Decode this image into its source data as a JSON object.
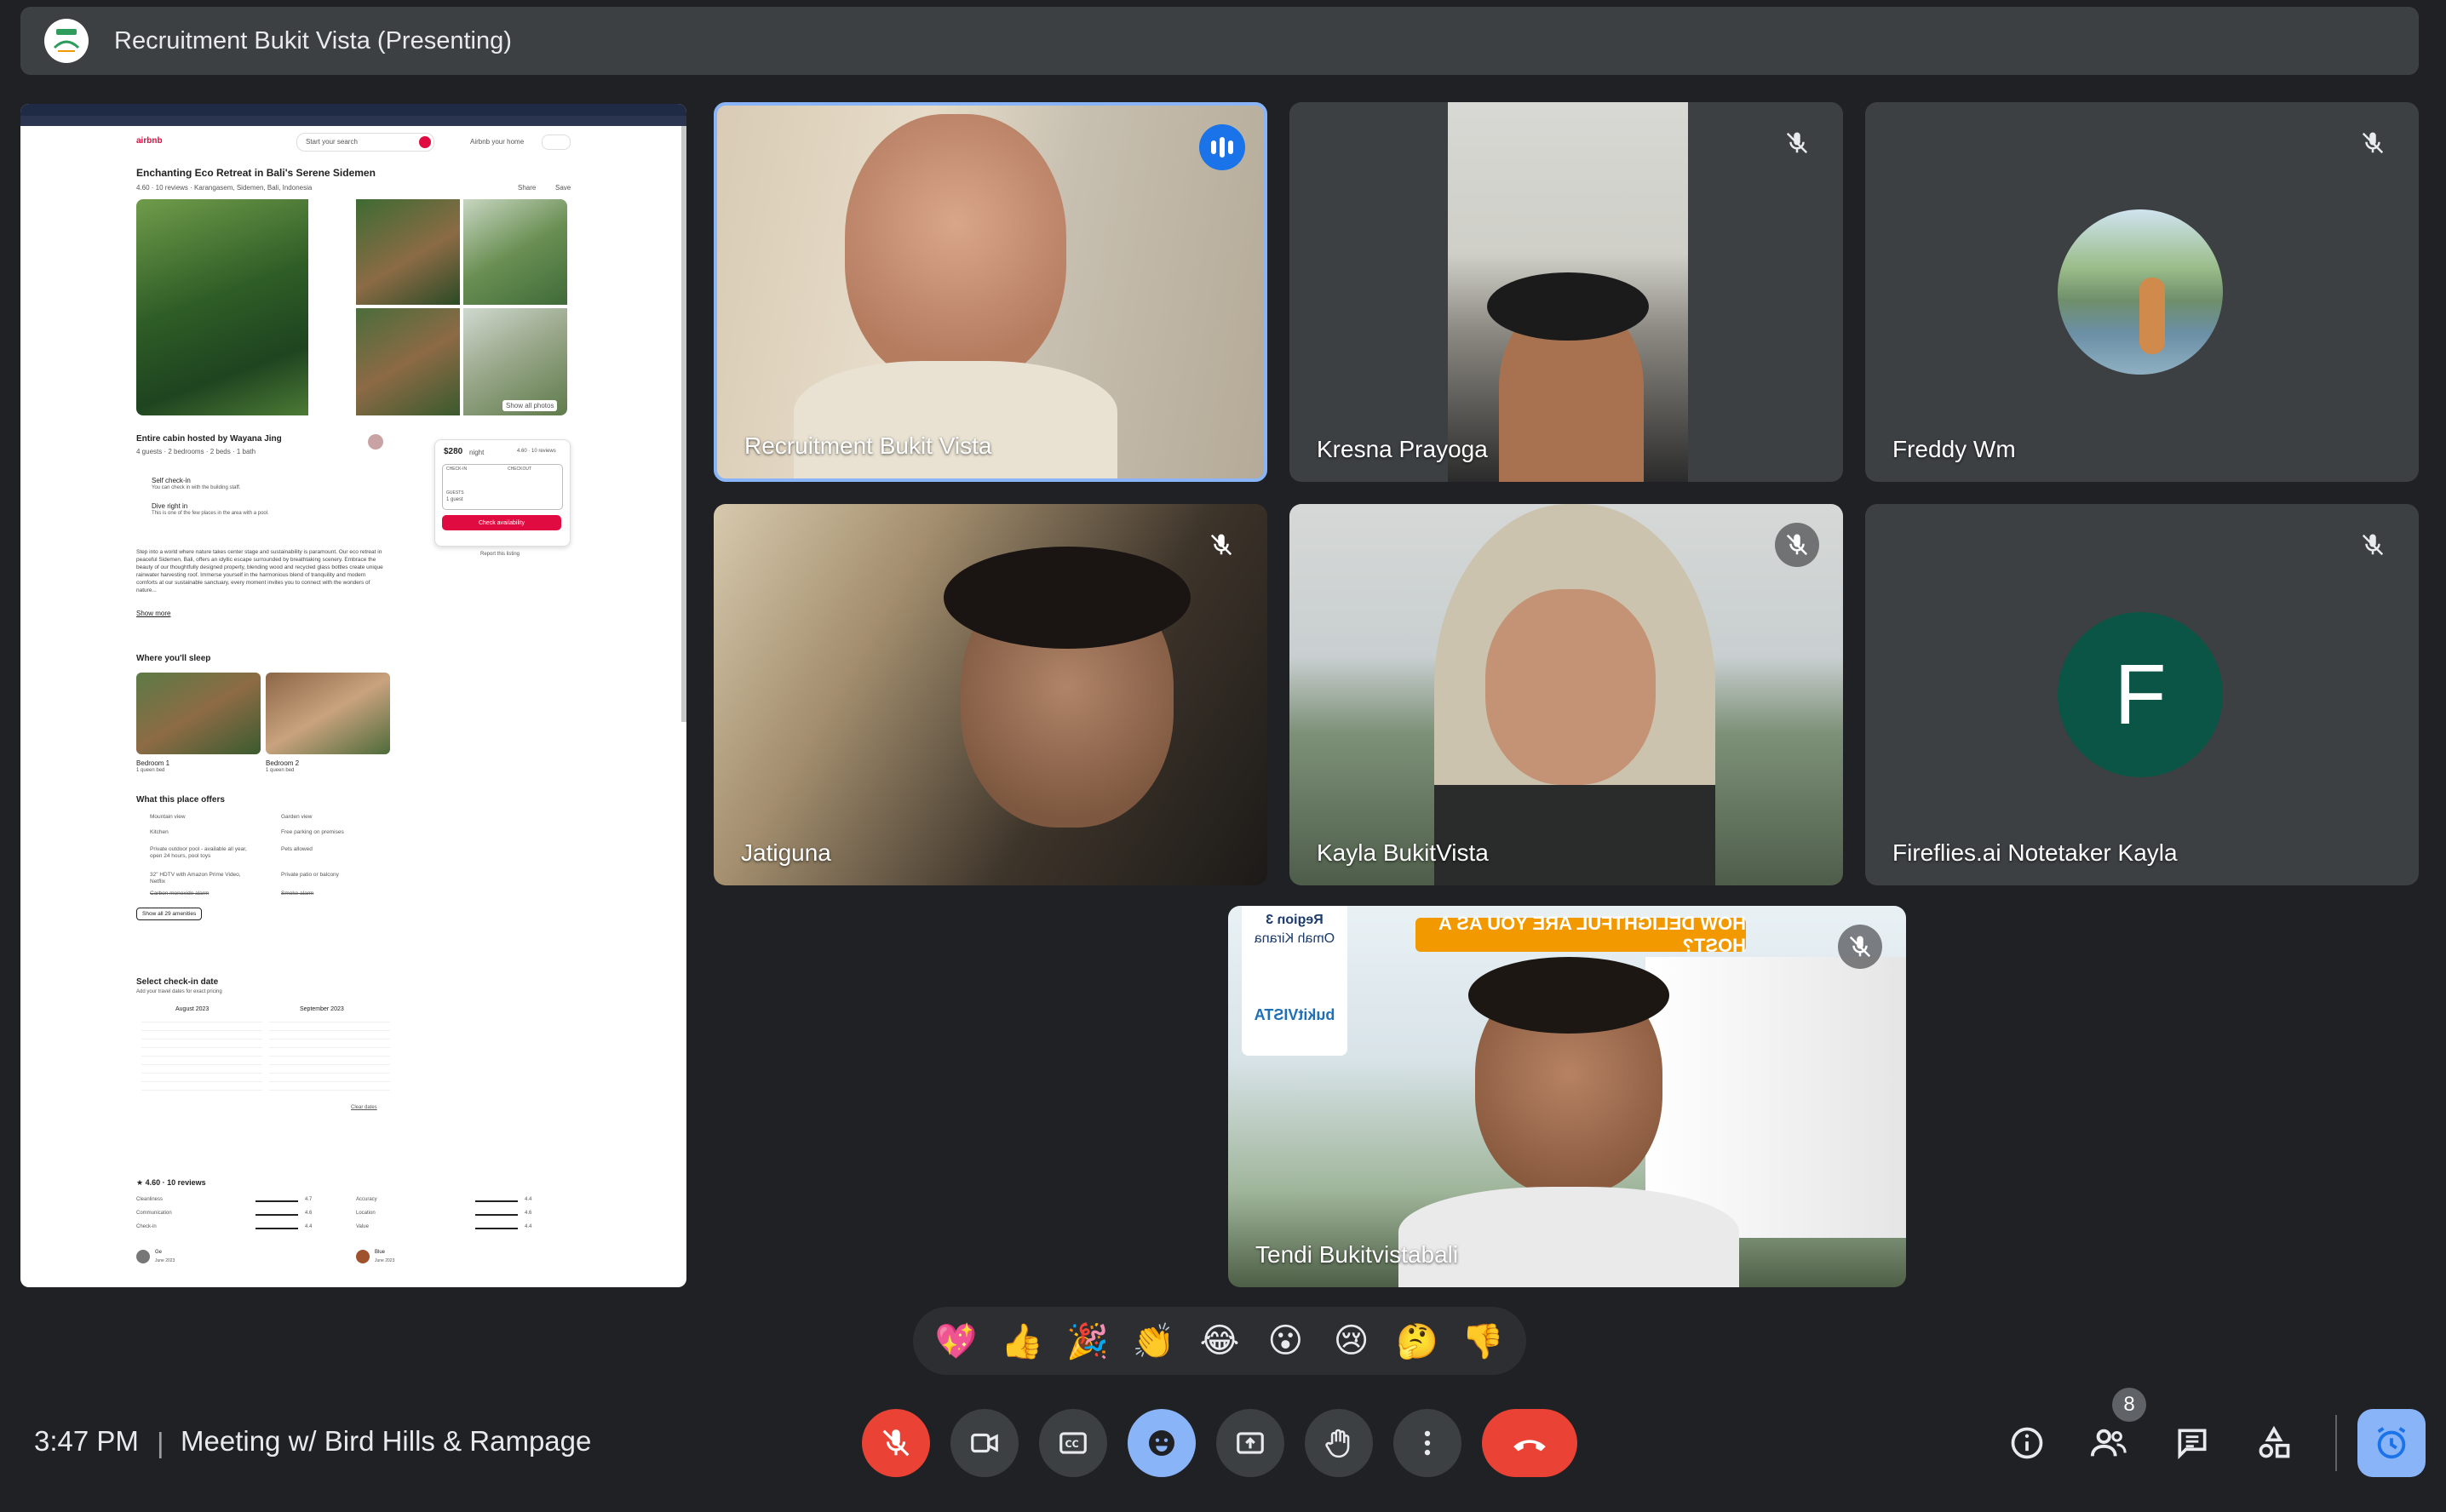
{
  "presentation": {
    "title": "Recruitment Bukit Vista (Presenting)"
  },
  "shared_screen": {
    "brand": "airbnb",
    "search_label": "Start your search",
    "host_link": "Airbnb your home",
    "listing_title": "Enchanting Eco Retreat in Bali's Serene Sidemen",
    "rating_line": "4.60 · 10 reviews · Karangasem, Sidemen, Bali, Indonesia",
    "share": "Share",
    "save": "Save",
    "show_photos": "Show all photos",
    "host_line": "Entire cabin hosted by Wayana Jing",
    "capacity": "4 guests · 2 bedrooms · 2 beds · 1 bath",
    "feature_1": "Self check-in",
    "feature_1_sub": "You can check in with the building staff.",
    "feature_2": "Dive right in",
    "feature_2_sub": "This is one of the few places in the area with a pool.",
    "price": "$280",
    "price_unit": "night",
    "rating_small": "4.60 · 10 reviews",
    "checkin": "CHECK-IN",
    "checkout": "CHECKOUT",
    "add_date": "Add date",
    "guests": "GUESTS",
    "guest_count": "1 guest",
    "cta": "Check availability",
    "report": "Report this listing",
    "description": "Step into a world where nature takes center stage and sustainability is paramount. Our eco retreat in peaceful Sidemen, Bali, offers an idyllic escape surrounded by breathtaking scenery. Embrace the beauty of our thoughtfully designed property, blending wood and recycled glass bottles create unique rainwater harvesting roof. Immerse yourself in the harmonious blend of tranquility and modern comforts at our sustainable sanctuary, every moment invites you to connect with the wonders of nature...",
    "show_more": "Show more",
    "sleep_heading": "Where you'll sleep",
    "bedroom1": "Bedroom 1",
    "bedroom1_sub": "1 queen bed",
    "bedroom2": "Bedroom 2",
    "bedroom2_sub": "1 queen bed",
    "offers_heading": "What this place offers",
    "amenities_left": [
      "Mountain view",
      "Kitchen",
      "Private outdoor pool - available all year, open 24 hours, pool toys",
      "32\" HDTV with Amazon Prime Video, Netflix",
      "Carbon monoxide alarm"
    ],
    "amenities_right": [
      "Garden view",
      "Free parking on premises",
      "Pets allowed",
      "Private patio or balcony",
      "Smoke alarm"
    ],
    "show_amenities": "Show all 29 amenities",
    "checkin_heading": "Select check-in date",
    "checkin_sub": "Add your travel dates for exact pricing",
    "month1": "August 2023",
    "month2": "September 2023",
    "clear_dates": "Clear dates",
    "reviews_heading": "★ 4.60 · 10 reviews",
    "review_cats_left": [
      "Cleanliness",
      "Communication",
      "Check-in"
    ],
    "review_vals_left": [
      "4.7",
      "4.6",
      "4.4"
    ],
    "review_cats_right": [
      "Accuracy",
      "Location",
      "Value"
    ],
    "review_vals_right": [
      "4.4",
      "4.6",
      "4.4"
    ],
    "reviewer1": "Ge",
    "reviewer1_date": "June 2023",
    "reviewer2": "Blue",
    "reviewer2_date": "June 2023"
  },
  "participants": [
    {
      "name": "Recruitment Bukit Vista"
    },
    {
      "name": "Kresna Prayoga"
    },
    {
      "name": "Freddy Wm"
    },
    {
      "name": "Jatiguna"
    },
    {
      "name": "Kayla BukitVista"
    },
    {
      "name": "Fireflies.ai Notetaker Kayla",
      "initial": "F"
    },
    {
      "name": "Tendi Bukitvistabali",
      "banner": "HOW DELIGHTFUL ARE YOU AS A HOST?",
      "region": "Region 3",
      "region_name": "Omah Kirana",
      "brand": "bukitVISTA"
    }
  ],
  "reactions": [
    "💖",
    "👍",
    "🎉",
    "👏",
    "😂",
    "😮",
    "😢",
    "🤔",
    "👎"
  ],
  "footer": {
    "time": "3:47 PM",
    "separator": "|",
    "meeting_title": "Meeting w/ Bird Hills & Rampage",
    "people_count": "8"
  },
  "colors": {
    "background": "#202124",
    "tile": "#3c4043",
    "accent": "#8ab4f8",
    "danger": "#ea4335",
    "airbnb": "#e00b41"
  }
}
